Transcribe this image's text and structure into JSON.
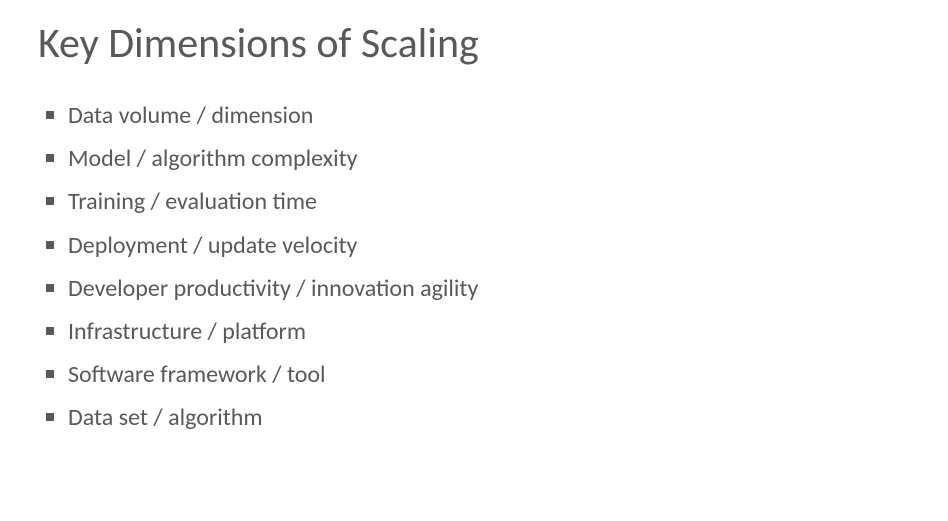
{
  "slide": {
    "title": "Key Dimensions of Scaling",
    "bullets": [
      "Data volume / dimension",
      "Model / algorithm complexity",
      "Training / evaluation time",
      "Deployment / update velocity",
      "Developer productivity / innovation agility",
      "Infrastructure / platform",
      "Software framework / tool",
      "Data set / algorithm"
    ]
  }
}
